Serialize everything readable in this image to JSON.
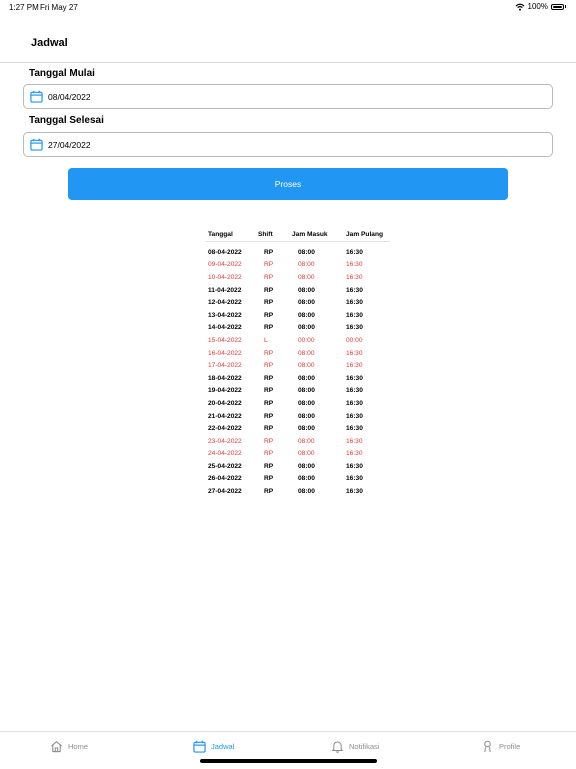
{
  "status_bar": {
    "time": "1:27 PM",
    "date": "Fri May 27",
    "battery": "100%"
  },
  "header": {
    "title": "Jadwal"
  },
  "form": {
    "start_label": "Tanggal Mulai",
    "start_value": "08/04/2022",
    "end_label": "Tanggal Selesai",
    "end_value": "27/04/2022",
    "submit_label": "Proses"
  },
  "table": {
    "headers": [
      "Tanggal",
      "Shift",
      "Jam Masuk",
      "Jam Pulang"
    ],
    "rows": [
      {
        "date": "08-04-2022",
        "shift": "RP",
        "in": "08:00",
        "out": "16:30",
        "holiday": false
      },
      {
        "date": "09-04-2022",
        "shift": "RP",
        "in": "08:00",
        "out": "16:30",
        "holiday": true
      },
      {
        "date": "10-04-2022",
        "shift": "RP",
        "in": "08:00",
        "out": "16:30",
        "holiday": true
      },
      {
        "date": "11-04-2022",
        "shift": "RP",
        "in": "08:00",
        "out": "16:30",
        "holiday": false
      },
      {
        "date": "12-04-2022",
        "shift": "RP",
        "in": "08:00",
        "out": "16:30",
        "holiday": false
      },
      {
        "date": "13-04-2022",
        "shift": "RP",
        "in": "08:00",
        "out": "16:30",
        "holiday": false
      },
      {
        "date": "14-04-2022",
        "shift": "RP",
        "in": "08:00",
        "out": "16:30",
        "holiday": false
      },
      {
        "date": "15-04-2022",
        "shift": "L",
        "in": "00:00",
        "out": "00:00",
        "holiday": true
      },
      {
        "date": "16-04-2022",
        "shift": "RP",
        "in": "08:00",
        "out": "16:30",
        "holiday": true
      },
      {
        "date": "17-04-2022",
        "shift": "RP",
        "in": "08:00",
        "out": "16:30",
        "holiday": true
      },
      {
        "date": "18-04-2022",
        "shift": "RP",
        "in": "08:00",
        "out": "16:30",
        "holiday": false
      },
      {
        "date": "19-04-2022",
        "shift": "RP",
        "in": "08:00",
        "out": "16:30",
        "holiday": false
      },
      {
        "date": "20-04-2022",
        "shift": "RP",
        "in": "08:00",
        "out": "16:30",
        "holiday": false
      },
      {
        "date": "21-04-2022",
        "shift": "RP",
        "in": "08:00",
        "out": "16:30",
        "holiday": false
      },
      {
        "date": "22-04-2022",
        "shift": "RP",
        "in": "08:00",
        "out": "16:30",
        "holiday": false
      },
      {
        "date": "23-04-2022",
        "shift": "RP",
        "in": "08:00",
        "out": "16:30",
        "holiday": true
      },
      {
        "date": "24-04-2022",
        "shift": "RP",
        "in": "08:00",
        "out": "16:30",
        "holiday": true
      },
      {
        "date": "25-04-2022",
        "shift": "RP",
        "in": "08:00",
        "out": "16:30",
        "holiday": false
      },
      {
        "date": "26-04-2022",
        "shift": "RP",
        "in": "08:00",
        "out": "16:30",
        "holiday": false
      },
      {
        "date": "27-04-2022",
        "shift": "RP",
        "in": "08:00",
        "out": "16:30",
        "holiday": false
      }
    ]
  },
  "tabs": [
    {
      "label": "Home",
      "icon": "home-icon",
      "active": false
    },
    {
      "label": "Jadwal",
      "icon": "calendar-icon",
      "active": true
    },
    {
      "label": "Notifikasi",
      "icon": "bell-icon",
      "active": false
    },
    {
      "label": "Profile",
      "icon": "person-icon",
      "active": false
    }
  ],
  "colors": {
    "accent": "#2196f3",
    "holiday": "#e53935",
    "inactive": "#8e8e93"
  }
}
